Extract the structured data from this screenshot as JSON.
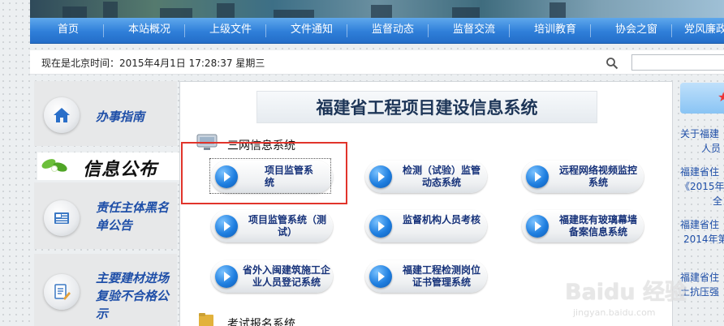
{
  "nav": {
    "items": [
      "首页",
      "本站概况",
      "上级文件",
      "文件通知",
      "监督动态",
      "监督交流",
      "培训教育",
      "协会之窗",
      "党风廉政"
    ]
  },
  "infobar": {
    "clock": "现在是北京时间：2015年4月1日 17:28:37  星期三",
    "search_placeholder": ""
  },
  "sidebar": {
    "guide_label": "办事指南",
    "info_label": "信息公布",
    "blacklist_label": "责任主体黑名单公告",
    "materials_label": "主要建材进场复验不合格公示"
  },
  "main": {
    "title": "福建省工程项目建设信息系统",
    "section_title": "三网信息系统",
    "exam_section_title": "考试报名系统",
    "buttons": [
      "项目监管系统",
      "检测（试验）监管动态系统",
      "远程网络视频监控系统",
      "项目监管系统（测试）",
      "监督机构人员考核",
      "福建既有玻璃幕墙备案信息系统",
      "省外入闽建筑施工企业人员登记系统",
      "福建工程检测岗位证书管理系统"
    ]
  },
  "right": {
    "lines": [
      "关于福建",
      "人员",
      "福建省住",
      "《2015年",
      "全",
      "福建省住",
      "2014年第",
      "福建省住",
      "土抗压强"
    ]
  },
  "watermark": {
    "main": "Baidu 经验",
    "sub": "jingyan.baidu.com"
  },
  "colors": {
    "nav_blue": "#2f7fd9",
    "link_blue": "#1f4fa8",
    "highlight_red": "#e1342b"
  }
}
